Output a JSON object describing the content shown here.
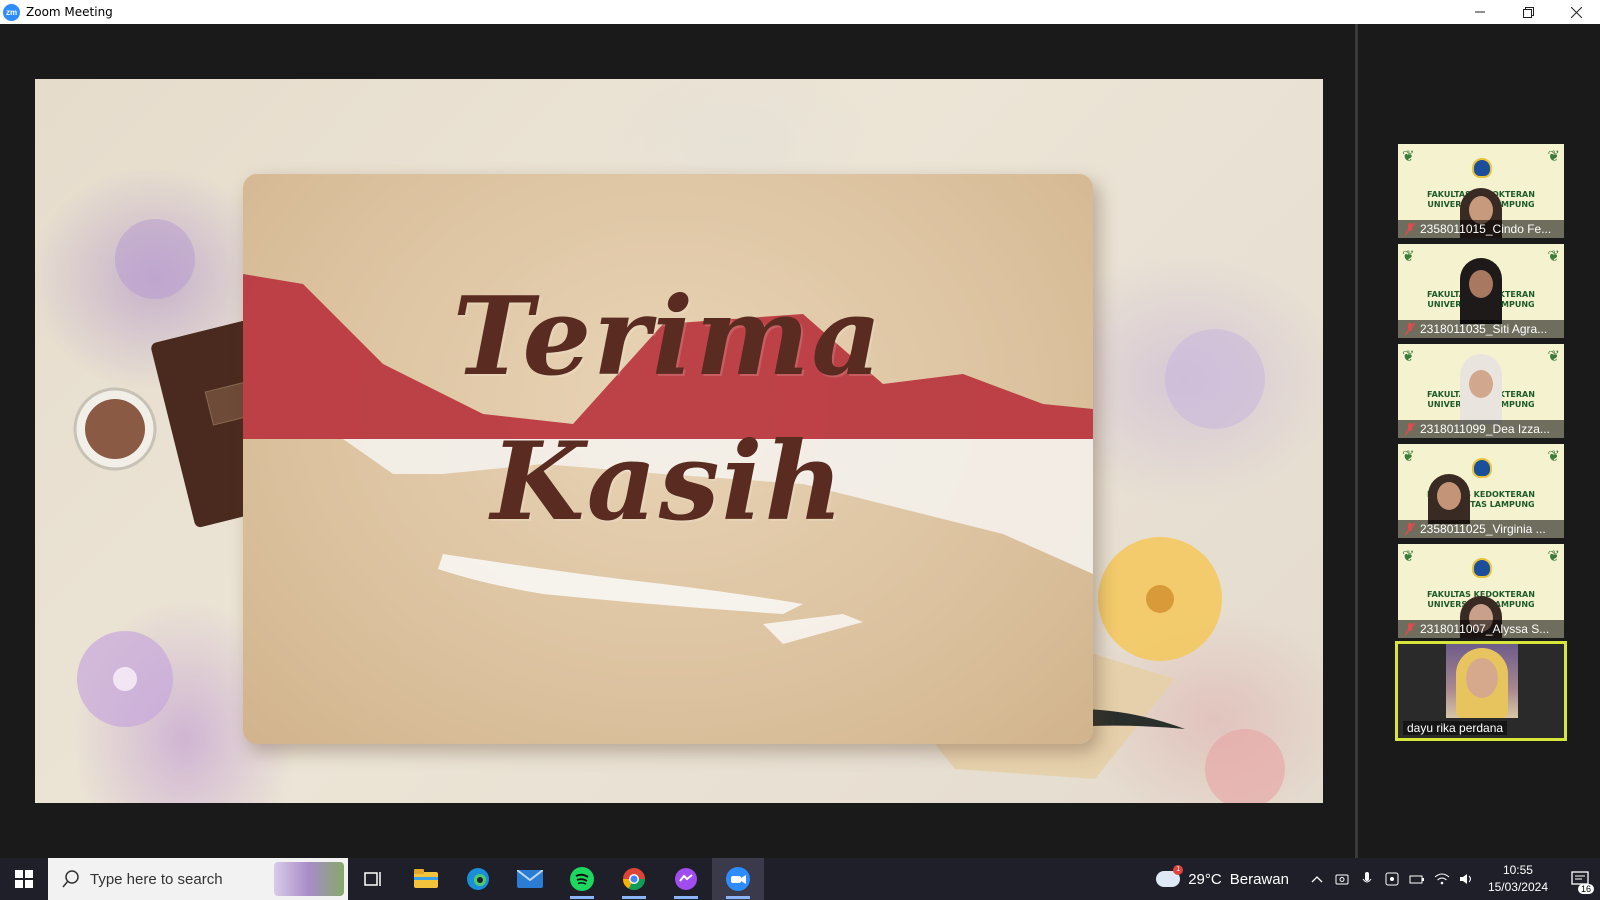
{
  "window": {
    "app_icon": "zm",
    "title": "Zoom Meeting",
    "controls": [
      "minimize-icon",
      "restore-icon",
      "close-icon"
    ]
  },
  "slide": {
    "line1": "Terima",
    "line2": "Kasih",
    "colors": {
      "text": "#5a2b20",
      "flag_red": "#b8323c",
      "paper": "#dcc29f"
    }
  },
  "participants": [
    {
      "name": "2358011015_Cindo Fe...",
      "institution_line1": "FAKULTAS KEDOKTERAN",
      "institution_line2": "UNIVERSITAS LAMPUNG",
      "muted": true
    },
    {
      "name": "2318011035_Siti Agra...",
      "institution_line1": "FAKULTAS KEDOKTERAN",
      "institution_line2": "UNIVERSITAS LAMPUNG",
      "muted": true
    },
    {
      "name": "2318011099_Dea Izza...",
      "institution_line1": "FAKULTAS KEDOKTERAN",
      "institution_line2": "UNIVERSITAS LAMPUNG",
      "muted": true
    },
    {
      "name": "2358011025_Virginia ...",
      "institution_line1": "FAKULTAS KEDOKTERAN",
      "institution_line2": "UNIVERSITAS LAMPUNG",
      "muted": true
    },
    {
      "name": "2318011007_Alyssa S...",
      "institution_line1": "FAKULTAS KEDOKTERAN",
      "institution_line2": "UNIVERSITAS LAMPUNG",
      "muted": true
    },
    {
      "name": "dayu rika perdana",
      "active_speaker": true
    }
  ],
  "taskbar": {
    "search_placeholder": "Type here to search",
    "apps": [
      "task-view-icon",
      "file-explorer-icon",
      "edge-icon",
      "mail-icon",
      "spotify-icon",
      "chrome-icon",
      "messenger-icon",
      "zoom-icon"
    ],
    "weather_temp": "29°C",
    "weather_desc": "Berawan",
    "weather_alert": "1",
    "time": "10:55",
    "date": "15/03/2024",
    "notifications": "16",
    "active_color": "#8ab4f8"
  }
}
